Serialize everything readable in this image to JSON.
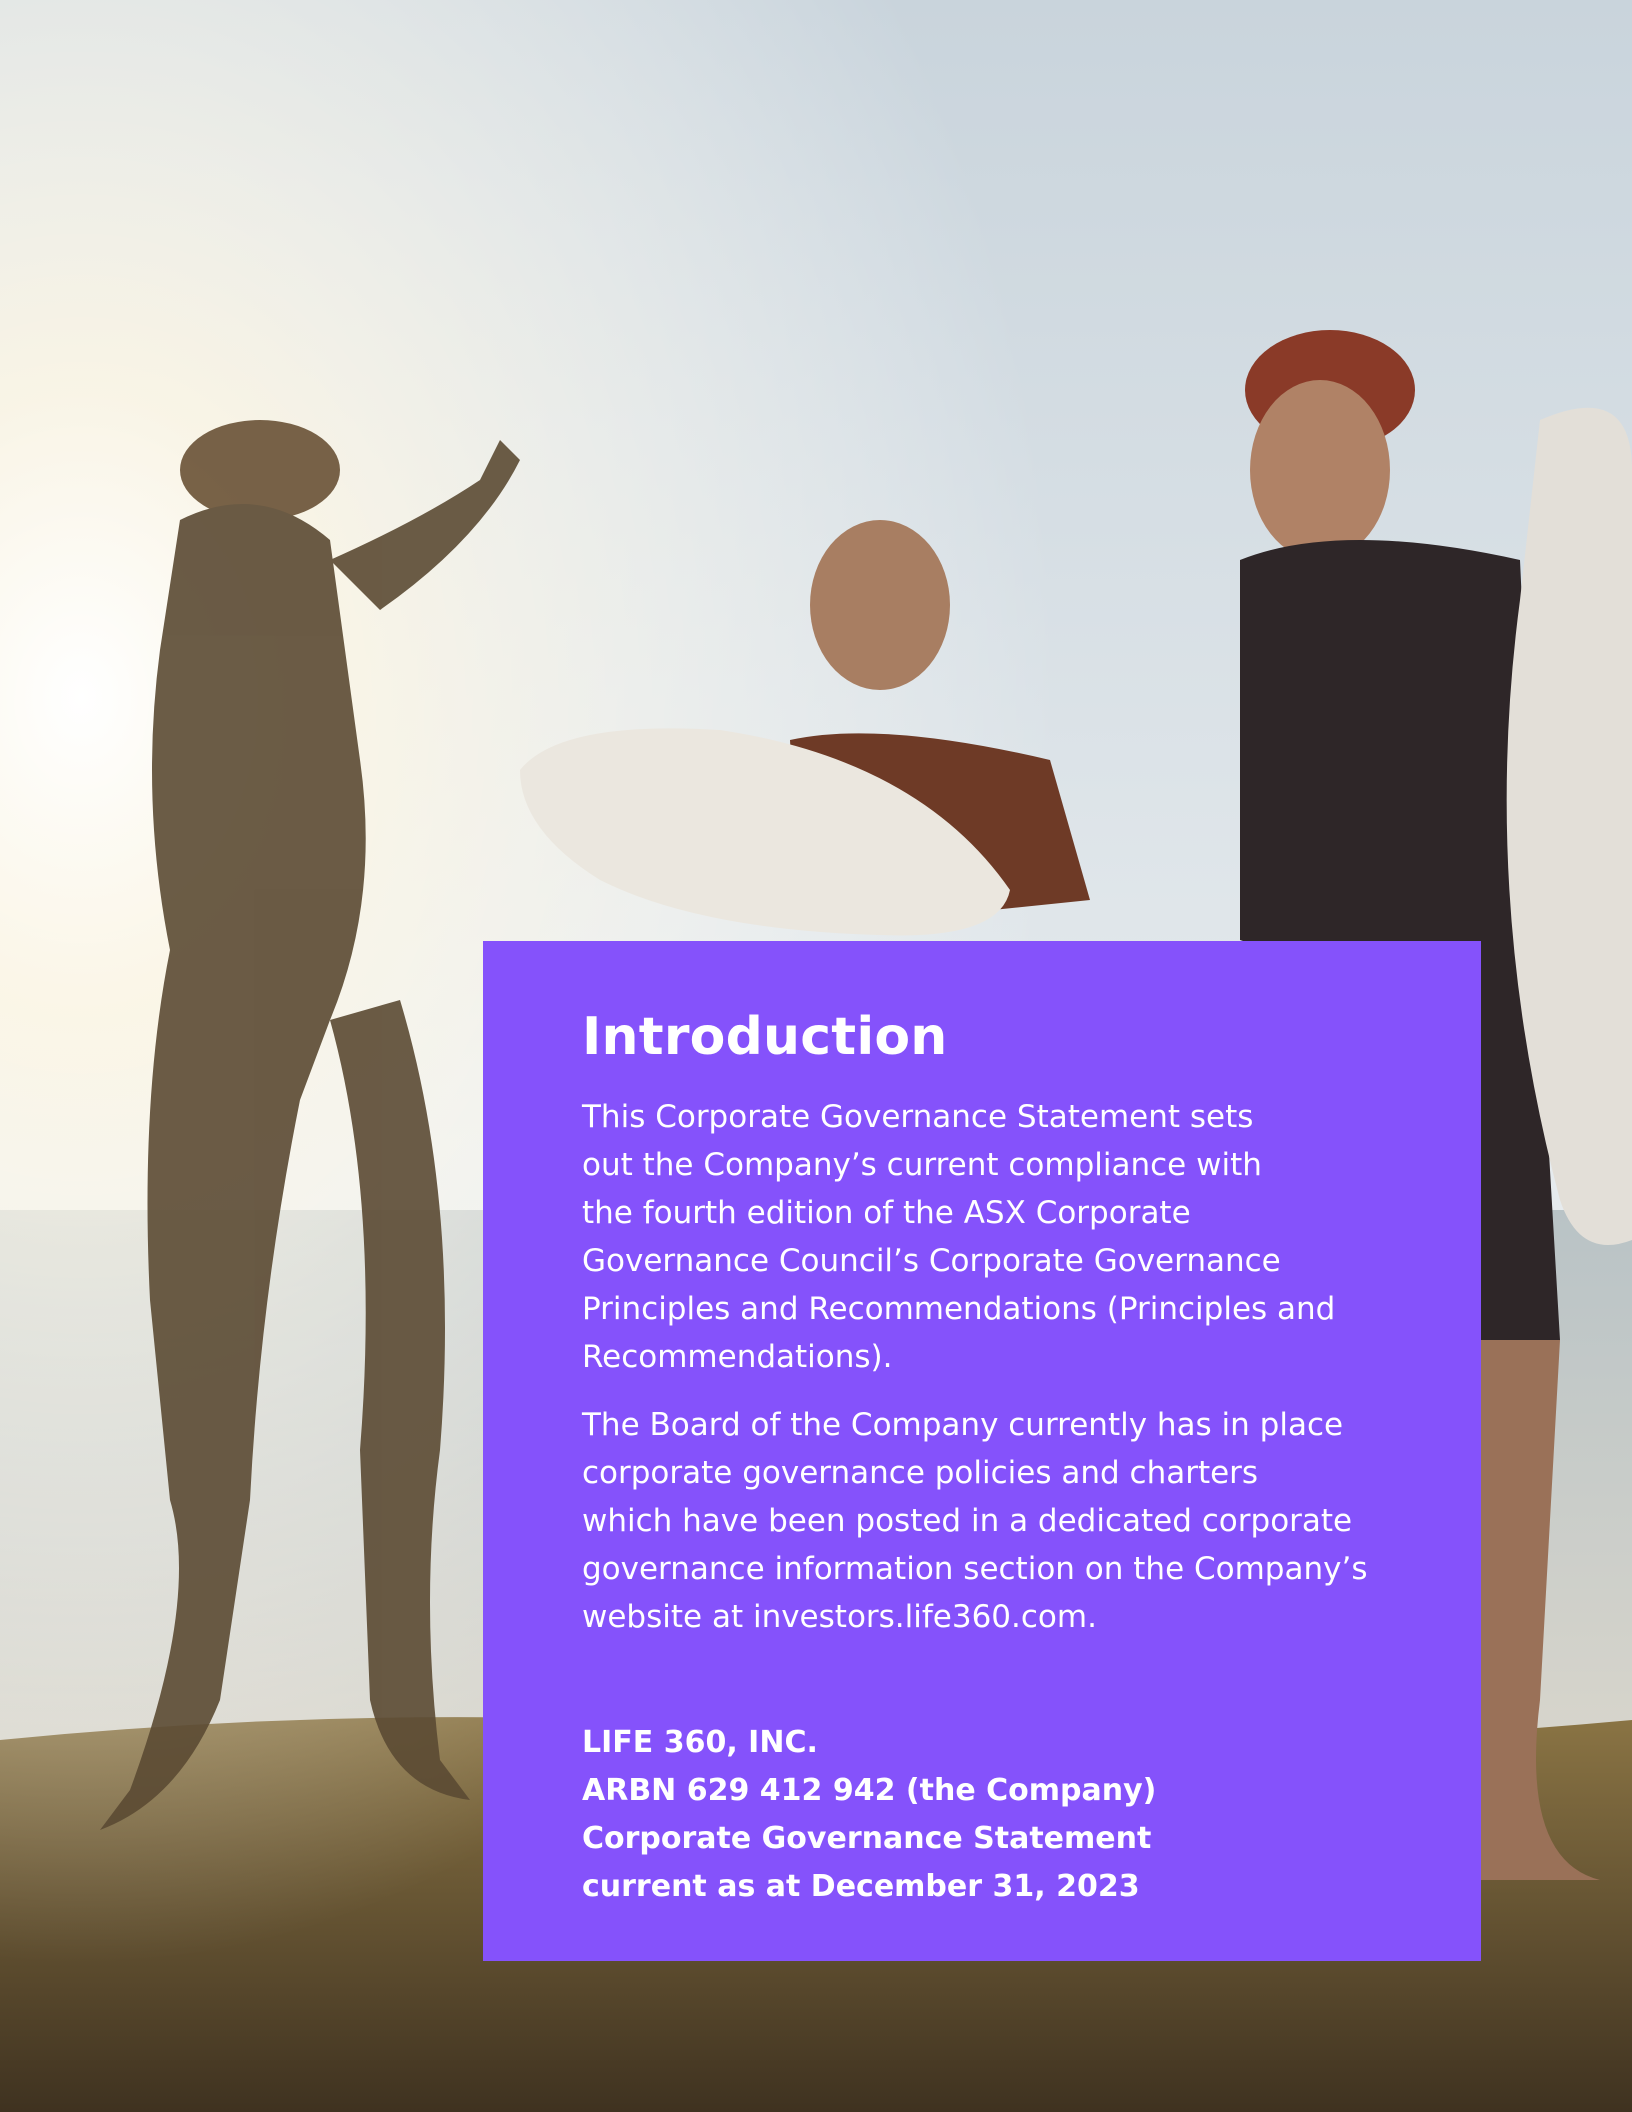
{
  "page": {
    "background_description_color": "#dce4ea"
  },
  "intro": {
    "heading": "Introduction",
    "paragraph1": "This Corporate Governance Statement sets\nout the Company’s current compliance with\nthe fourth edition of the ASX Corporate\nGovernance Council’s Corporate Governance\nPrinciples and Recommendations (Principles and\nRecommendations).",
    "paragraph2": "The Board of the Company currently has in place\ncorporate governance policies and charters\nwhich have been posted in a dedicated corporate\ngovernance information section on the Company’s\nwebsite at investors.life360.com.",
    "company_lines": [
      "LIFE 360, INC.",
      "ARBN 629 412 942 (the Company)",
      "Corporate Governance Statement",
      "current as at December 31, 2023"
    ]
  },
  "colors": {
    "panel": "#8552fb",
    "text": "#ffffff",
    "sky": "#dbe3e8",
    "ground": "#6b5530"
  }
}
